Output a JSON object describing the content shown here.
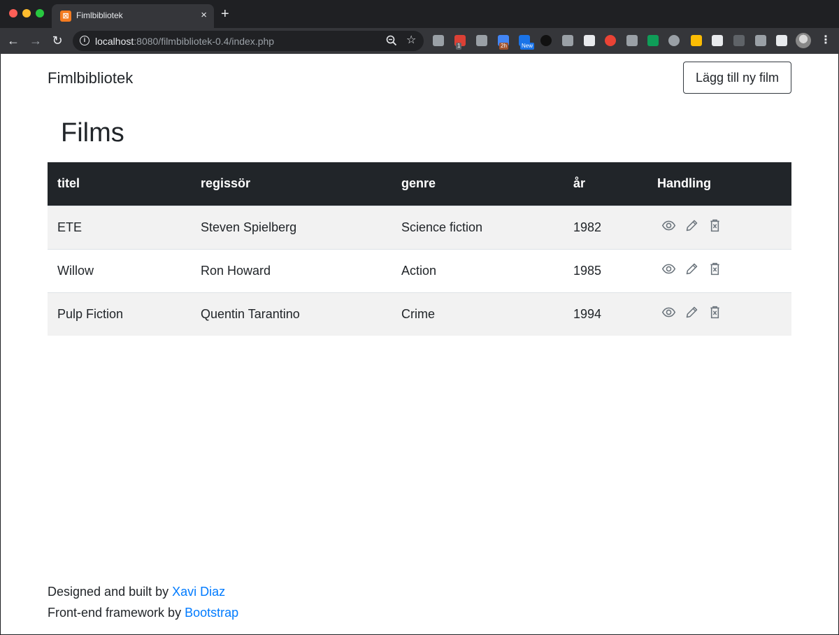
{
  "browser": {
    "tab_title": "Fimlbibliotek",
    "tab_close": "×",
    "new_tab": "+",
    "url_host": "localhost",
    "url_rest": ":8080/filmbibliotek-0.4/index.php",
    "extensions": [
      {
        "icon": "drive-icon",
        "color": "#9aa0a6"
      },
      {
        "icon": "todoist-icon",
        "color": "#db4035",
        "badge": "1",
        "badge_color": "#5f6368"
      },
      {
        "icon": "lightbulb-icon",
        "color": "#9aa0a6"
      },
      {
        "icon": "calendar-icon",
        "color": "#4285f4",
        "badge": "2h",
        "badge_color": "#a0522d"
      },
      {
        "icon": "s-extension-icon",
        "color": "#1a73e8",
        "badge": "New",
        "badge_color": "#1a73e8"
      },
      {
        "icon": "circle-extension-icon",
        "color": "#111111"
      },
      {
        "icon": "camera-icon",
        "color": "#9aa0a6"
      },
      {
        "icon": "screenshot-icon",
        "color": "#e8eaed"
      },
      {
        "icon": "color-wheel-icon",
        "color": "#ea4335"
      },
      {
        "icon": "facebook-icon",
        "color": "#9aa0a6"
      },
      {
        "icon": "equalizer-icon",
        "color": "#0f9d58"
      },
      {
        "icon": "download-circle-icon",
        "color": "#9aa0a6"
      },
      {
        "icon": "google-drive-icon",
        "color": "#fbbc04"
      },
      {
        "icon": "sync-icon",
        "color": "#e8eaed"
      },
      {
        "icon": "cloud-icon",
        "color": "#5f6368"
      },
      {
        "icon": "down-arrow-icon",
        "color": "#9aa0a6"
      },
      {
        "icon": "puzzle-icon",
        "color": "#e8eaed"
      }
    ]
  },
  "page": {
    "brand": "Fimlbibliotek",
    "add_button": "Lägg till ny film",
    "heading": "Films"
  },
  "table": {
    "headers": [
      "titel",
      "regissör",
      "genre",
      "år",
      "Handling"
    ],
    "rows": [
      {
        "titel": "ETE",
        "regissor": "Steven Spielberg",
        "genre": "Science fiction",
        "ar": "1982"
      },
      {
        "titel": "Willow",
        "regissor": "Ron Howard",
        "genre": "Action",
        "ar": "1985"
      },
      {
        "titel": "Pulp Fiction",
        "regissor": "Quentin Tarantino",
        "genre": "Crime",
        "ar": "1994"
      }
    ],
    "action_icons": [
      "eye-icon",
      "pencil-icon",
      "trash-icon"
    ],
    "action_color": "#6c757d"
  },
  "footer": {
    "line1_prefix": "Designed and built by ",
    "line1_link": "Xavi Diaz",
    "line2_prefix": "Front-end framework by ",
    "line2_link": "Bootstrap",
    "link_color": "#007bff"
  }
}
